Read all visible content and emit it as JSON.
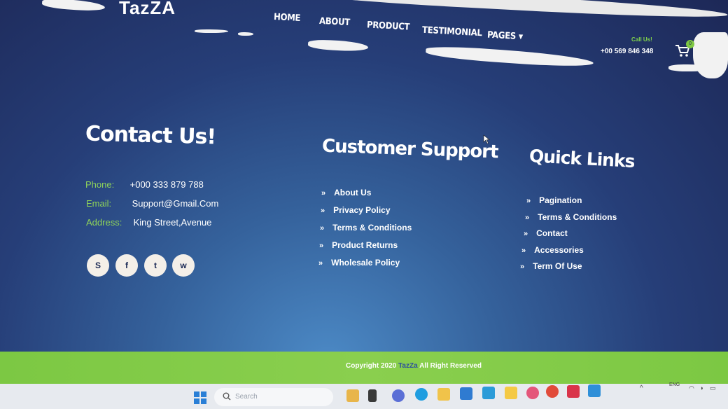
{
  "header": {
    "logo": "TazZA",
    "nav": [
      "HOME",
      "ABOUT",
      "PRODUCT",
      "TESTIMONIAL",
      "PAGES"
    ],
    "call_label": "Call Us!",
    "phone": "+00 569 846 348",
    "cart_count": "0"
  },
  "contact": {
    "title": "Contact Us!",
    "rows": [
      {
        "label": "Phone:",
        "value": "+000 333 879 788"
      },
      {
        "label": "Email:",
        "value": "Support@Gmail.Com"
      },
      {
        "label": "Address:",
        "value": "King Street,Avenue"
      }
    ],
    "social": [
      "skype-icon",
      "facebook-icon",
      "twitter-icon",
      "whatsapp-icon"
    ]
  },
  "support": {
    "title": "Customer Support",
    "links": [
      "About Us",
      "Privacy Policy",
      "Terms & Conditions",
      "Product Returns",
      "Wholesale Policy"
    ]
  },
  "quick": {
    "title": "Quick Links",
    "links": [
      "Pagination",
      "Terms & Conditions",
      "Contact",
      "Accessories",
      "Term Of Use"
    ]
  },
  "footer": {
    "copyright_prefix": "Copyright 2020",
    "brand": "TazZa",
    "copyright_suffix": "All Right Reserved"
  },
  "taskbar": {
    "search_placeholder": "Search",
    "lang": "ENG"
  },
  "colors": {
    "accent_green": "#7fc843",
    "label_green": "#8fd35a",
    "background_navy": "#1d2857"
  }
}
